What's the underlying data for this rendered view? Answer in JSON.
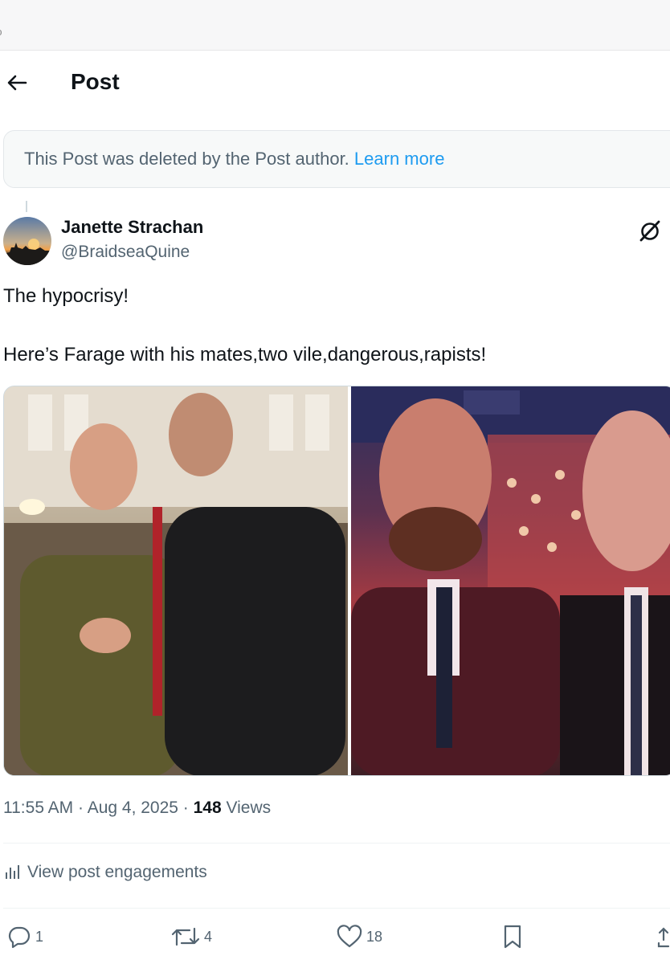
{
  "header": {
    "title": "Post"
  },
  "banner": {
    "message": "This Post was deleted by the Post author.",
    "link": "Learn more"
  },
  "author": {
    "name": "Janette Strachan",
    "handle": "@BraidseaQuine"
  },
  "post": {
    "line1": "The hypocrisy!",
    "line2": "Here’s Farage with his mates,two vile,dangerous,rapists!"
  },
  "meta": {
    "time": "11:55 AM",
    "date": "Aug 4, 2025",
    "views_count": "148",
    "views_label": "Views"
  },
  "engagements": {
    "label": "View post engagements"
  },
  "actions": {
    "replies": "1",
    "reposts": "4",
    "likes": "18"
  },
  "icons": [
    "back-arrow-icon",
    "grok-icon",
    "analytics-icon",
    "reply-icon",
    "repost-icon",
    "like-icon",
    "bookmark-icon",
    "share-icon"
  ]
}
